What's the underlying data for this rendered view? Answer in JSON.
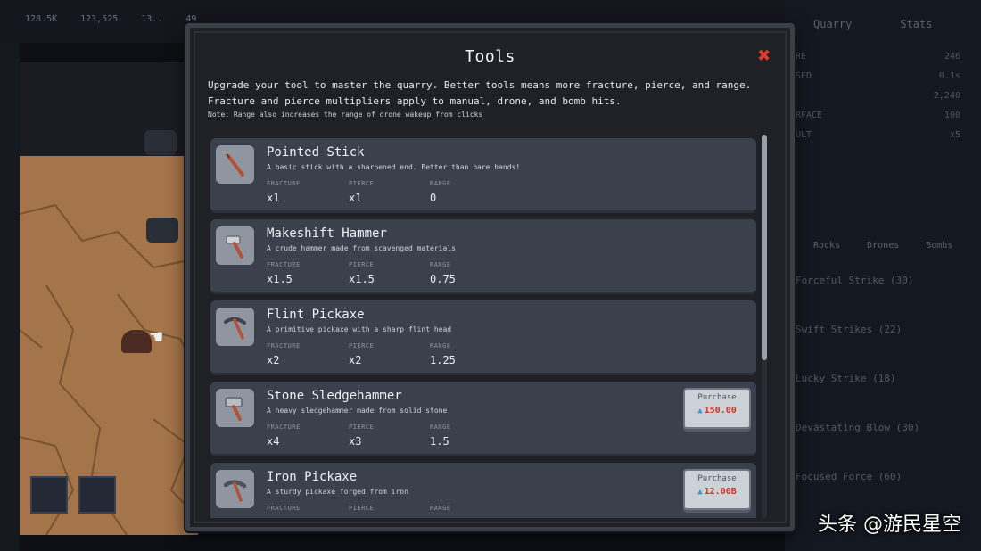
{
  "modal": {
    "title": "Tools",
    "close_symbol": "✖",
    "description": "Upgrade your tool to master the quarry. Better tools means more fracture, pierce, and range. Fracture and pierce multipliers apply to manual, drone, and bomb hits.",
    "note": "Note: Range also increases the range of drone wakeup from clicks"
  },
  "stat_labels": {
    "fracture": "FRACTURE",
    "pierce": "PIERCE",
    "range": "RANGE"
  },
  "tools": [
    {
      "name": "Pointed Stick",
      "desc": "A basic stick with a sharpened end. Better than bare hands!",
      "icon": "stick-icon",
      "fracture": "x1",
      "pierce": "x1",
      "range": "0"
    },
    {
      "name": "Makeshift Hammer",
      "desc": "A crude hammer made from scavenged materials",
      "icon": "hammer-icon",
      "fracture": "x1.5",
      "pierce": "x1.5",
      "range": "0.75"
    },
    {
      "name": "Flint Pickaxe",
      "desc": "A primitive pickaxe with a sharp flint head",
      "icon": "pickaxe-icon",
      "fracture": "x2",
      "pierce": "x2",
      "range": "1.25"
    },
    {
      "name": "Stone Sledgehammer",
      "desc": "A heavy sledgehammer made from solid stone",
      "icon": "sledgehammer-icon",
      "fracture": "x4",
      "pierce": "x3",
      "range": "1.5",
      "purchase_label": "Purchase",
      "price": "150.00"
    },
    {
      "name": "Iron Pickaxe",
      "desc": "A sturdy pickaxe forged from iron",
      "icon": "iron-pickaxe-icon",
      "fracture": "",
      "pierce": "",
      "range": "",
      "purchase_label": "Purchase",
      "price": "12.00B"
    }
  ],
  "background": {
    "top_stats": [
      "128.5K",
      "123,525",
      "13..",
      "49"
    ],
    "right_tabs": [
      "Quarry",
      "Stats"
    ],
    "right_rows": [
      [
        "RE",
        "246"
      ],
      [
        "SED",
        "0.1s"
      ],
      [
        "",
        "2,240"
      ],
      [
        "RFACE",
        "100"
      ],
      [
        "ULT",
        "x5"
      ]
    ],
    "sub_tabs": [
      "Rocks",
      "Drones",
      "Bombs"
    ],
    "upgrades": [
      "Forceful Strike (30)",
      "Swift Strikes (22)",
      "Lucky Strike (18)",
      "Devastating Blow (30)",
      "Focused Force (60)"
    ]
  },
  "watermark": "头条 @游民星空",
  "colors": {
    "accent_red": "#e23b2e",
    "panel": "#1f2126",
    "card": "#3a414c",
    "price": "#c0392b"
  }
}
